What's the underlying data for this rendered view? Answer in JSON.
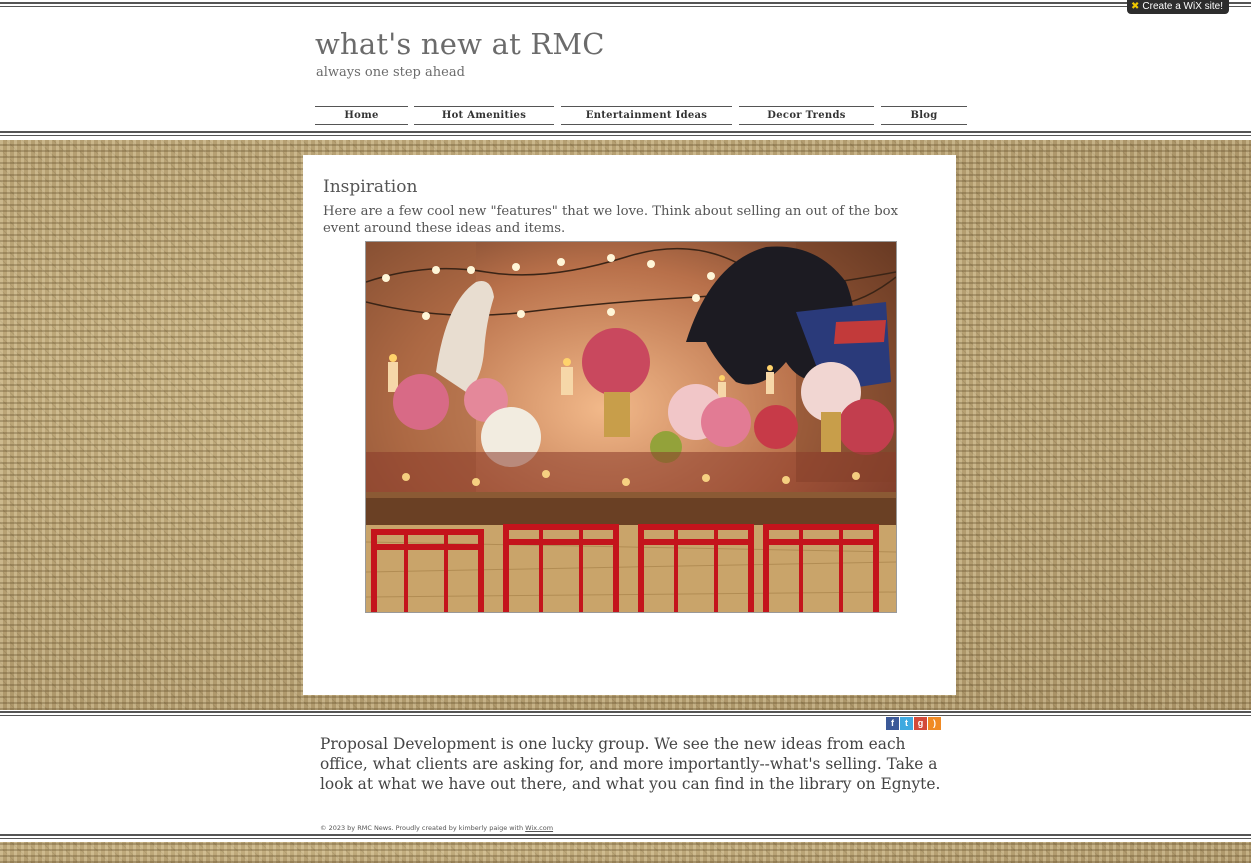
{
  "wix_badge": {
    "label": "Create a WiX site!"
  },
  "header": {
    "title": "what's new at RMC",
    "tagline": "always one step ahead"
  },
  "nav": {
    "items": [
      {
        "label": "Home"
      },
      {
        "label": "Hot Amenities"
      },
      {
        "label": "Entertainment Ideas"
      },
      {
        "label": "Decor Trends"
      },
      {
        "label": "Blog"
      }
    ]
  },
  "content": {
    "heading": "Inspiration",
    "body": "Here are a few cool new \"features\"  that we love.  Think about selling an out of the box event around these ideas and items."
  },
  "social": {
    "icons": [
      "facebook-icon",
      "twitter-icon",
      "google-plus-icon",
      "rss-icon"
    ],
    "colors": {
      "facebook": "#3b5998",
      "twitter": "#3fa9e0",
      "google_plus": "#d24a3a",
      "rss": "#f08a24"
    }
  },
  "footer": {
    "text": "Proposal Development is one lucky group. We see the new ideas from each office, what clients are asking for, and more importantly--what's selling. Take a look at what we have out there, and what you can find in the library on Egnyte.",
    "copyright_prefix": "© 2023 by RMC News. Proudly created by kimberly paige with ",
    "copyright_link": "Wix.com"
  },
  "colors": {
    "title_text": "#6b6b6b",
    "body_text": "#555555",
    "rule_lines": "#555555",
    "burlap": "#b59f72"
  }
}
